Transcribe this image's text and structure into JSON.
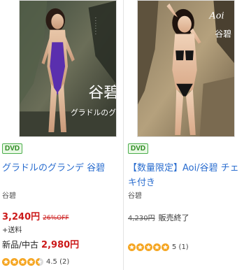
{
  "products": [
    {
      "badge": "DVD",
      "title": "グラドルのグランデ 谷碧",
      "maker": "谷碧",
      "price": "3,240円",
      "discount": "26%OFF",
      "shipping": "+送料",
      "used_label": "新品/中古",
      "used_price": "2,980円",
      "rating_text": "4.5 (2)",
      "rating": 4.5,
      "cover_text": {
        "name": "谷碧",
        "subtitle": "グラドルのグランデ"
      }
    },
    {
      "badge": "DVD",
      "title": "【数量限定】Aoi/谷碧 チェキ付き",
      "maker": "谷碧",
      "old_price": "4,230円",
      "status": "販売終了",
      "rating_text": "5 (1)",
      "rating": 5,
      "cover_text": {
        "latin": "Aoi",
        "name": "谷碧"
      }
    }
  ],
  "colors": {
    "link": "#2a6dcf",
    "price": "#cc1a1a",
    "badge_green": "#2b8a1f",
    "star": "#f5a623"
  }
}
